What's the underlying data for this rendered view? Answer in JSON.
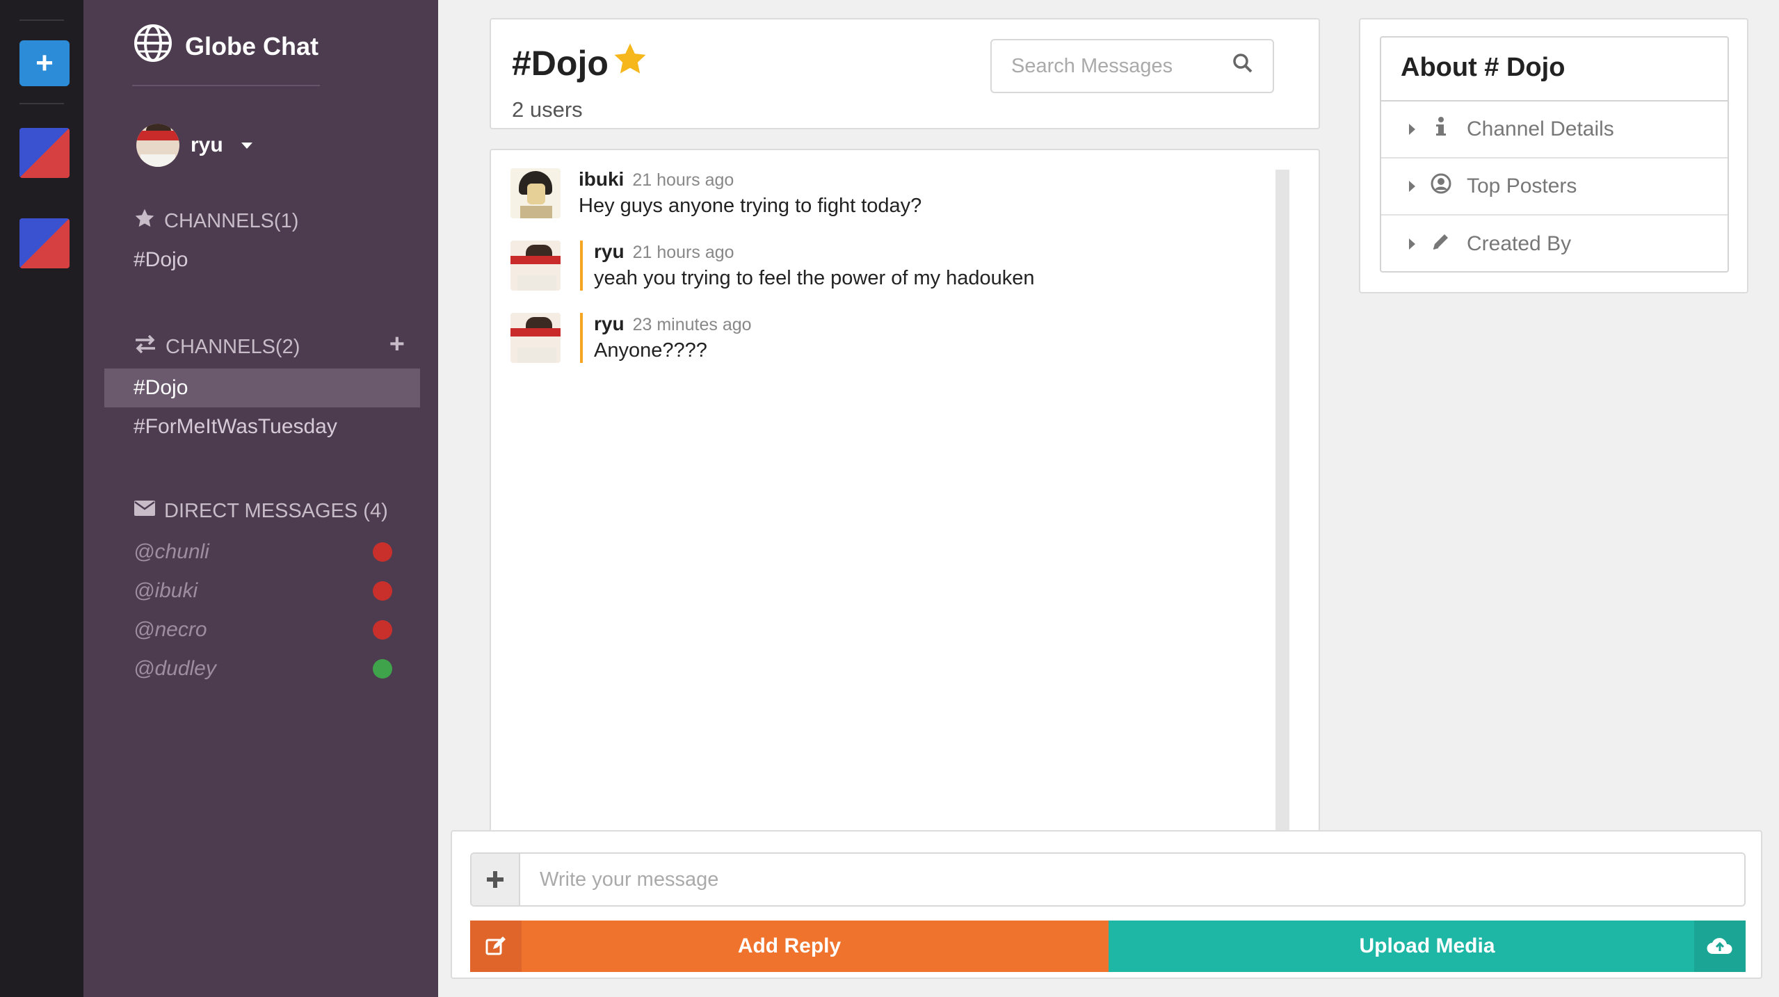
{
  "rail": {
    "add_label": "+",
    "team_colors": [
      "#3a52cf",
      "#d64040"
    ]
  },
  "sidebar": {
    "brand": "Globe Chat",
    "user": {
      "name": "ryu"
    },
    "starred": {
      "header": "CHANNELS(1)",
      "items": [
        {
          "label": "#Dojo"
        }
      ]
    },
    "channels": {
      "header": "CHANNELS(2)",
      "add_label": "+",
      "items": [
        {
          "label": "#Dojo",
          "active": true
        },
        {
          "label": "#ForMeItWasTuesday",
          "active": false
        }
      ]
    },
    "direct_messages": {
      "header": "DIRECT MESSAGES (4)",
      "items": [
        {
          "label": "@chunli",
          "status": "offline",
          "status_color": "#c9302c"
        },
        {
          "label": "@ibuki",
          "status": "offline",
          "status_color": "#c9302c"
        },
        {
          "label": "@necro",
          "status": "offline",
          "status_color": "#c9302c"
        },
        {
          "label": "@dudley",
          "status": "online",
          "status_color": "#3ea34a"
        }
      ]
    }
  },
  "header": {
    "channel": "#Dojo",
    "user_count": "2 users",
    "search_placeholder": "Search Messages"
  },
  "messages": [
    {
      "author": "ibuki",
      "time": "21 hours ago",
      "text": "Hey guys anyone trying to fight today?"
    },
    {
      "author": "ryu",
      "time": "21 hours ago",
      "text": "yeah you trying to feel the power of my hadouken"
    },
    {
      "author": "ryu",
      "time": "23 minutes ago",
      "text": "Anyone????"
    }
  ],
  "about": {
    "title": "About # Dojo",
    "sections": [
      {
        "label": "Channel Details",
        "icon": "info-icon"
      },
      {
        "label": "Top Posters",
        "icon": "user-circle-icon"
      },
      {
        "label": "Created By",
        "icon": "pencil-icon"
      }
    ]
  },
  "composer": {
    "placeholder": "Write your message",
    "reply_label": "Add Reply",
    "upload_label": "Upload Media"
  },
  "colors": {
    "accent_orange": "#f0732d",
    "accent_teal": "#1eb6a4",
    "sidebar_bg": "#4d3c4f",
    "star": "#f5b71c"
  }
}
